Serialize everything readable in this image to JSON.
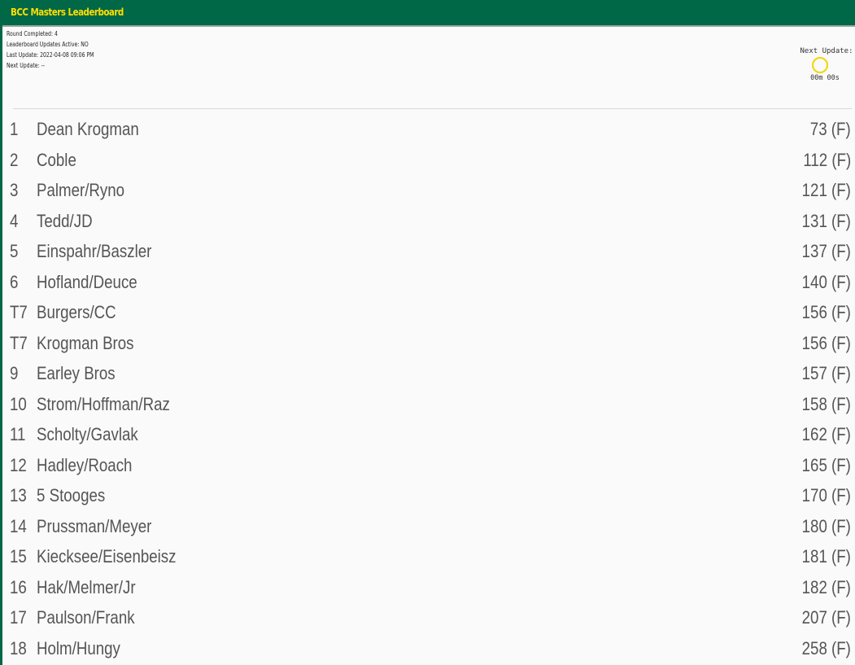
{
  "header": {
    "title": "BCC Masters Leaderboard"
  },
  "info": {
    "round_completed": "Round Completed: 4",
    "updates_active": "Leaderboard Updates Active: NO",
    "last_update": "Last Update: 2022-04-08 09:06 PM",
    "next_update": "Next Update: --"
  },
  "timer": {
    "label": "Next Update:",
    "value": "00m 00s",
    "ring_color": "#f2d600"
  },
  "colors": {
    "header_bg": "#006747",
    "header_text": "#ffdf00"
  },
  "leaderboard": [
    {
      "pos": "1",
      "name": "Dean Krogman",
      "score": "73 (F)"
    },
    {
      "pos": "2",
      "name": "Coble",
      "score": "112 (F)"
    },
    {
      "pos": "3",
      "name": "Palmer/Ryno",
      "score": "121 (F)"
    },
    {
      "pos": "4",
      "name": "Tedd/JD",
      "score": "131 (F)"
    },
    {
      "pos": "5",
      "name": "Einspahr/Baszler",
      "score": "137 (F)"
    },
    {
      "pos": "6",
      "name": "Hofland/Deuce",
      "score": "140 (F)"
    },
    {
      "pos": "T7",
      "name": "Burgers/CC",
      "score": "156 (F)"
    },
    {
      "pos": "T7",
      "name": "Krogman Bros",
      "score": "156 (F)"
    },
    {
      "pos": "9",
      "name": "Earley Bros",
      "score": "157 (F)"
    },
    {
      "pos": "10",
      "name": "Strom/Hoffman/Raz",
      "score": "158 (F)"
    },
    {
      "pos": "11",
      "name": "Scholty/Gavlak",
      "score": "162 (F)"
    },
    {
      "pos": "12",
      "name": "Hadley/Roach",
      "score": "165 (F)"
    },
    {
      "pos": "13",
      "name": "5 Stooges",
      "score": "170 (F)"
    },
    {
      "pos": "14",
      "name": "Prussman/Meyer",
      "score": "180 (F)"
    },
    {
      "pos": "15",
      "name": "Kiecksee/Eisenbeisz",
      "score": "181 (F)"
    },
    {
      "pos": "16",
      "name": "Hak/Melmer/Jr",
      "score": "182 (F)"
    },
    {
      "pos": "17",
      "name": "Paulson/Frank",
      "score": "207 (F)"
    },
    {
      "pos": "18",
      "name": "Holm/Hungy",
      "score": "258 (F)"
    }
  ]
}
